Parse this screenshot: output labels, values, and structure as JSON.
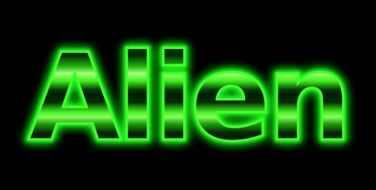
{
  "logo": {
    "text": "Alien",
    "colors": {
      "background": "#000000",
      "glow": "#22ff22",
      "stroke": "#44ff2a",
      "fill_bright": "#3cf01c",
      "fill_dark": "#052a03",
      "highlight": "#a6ff7a"
    }
  }
}
